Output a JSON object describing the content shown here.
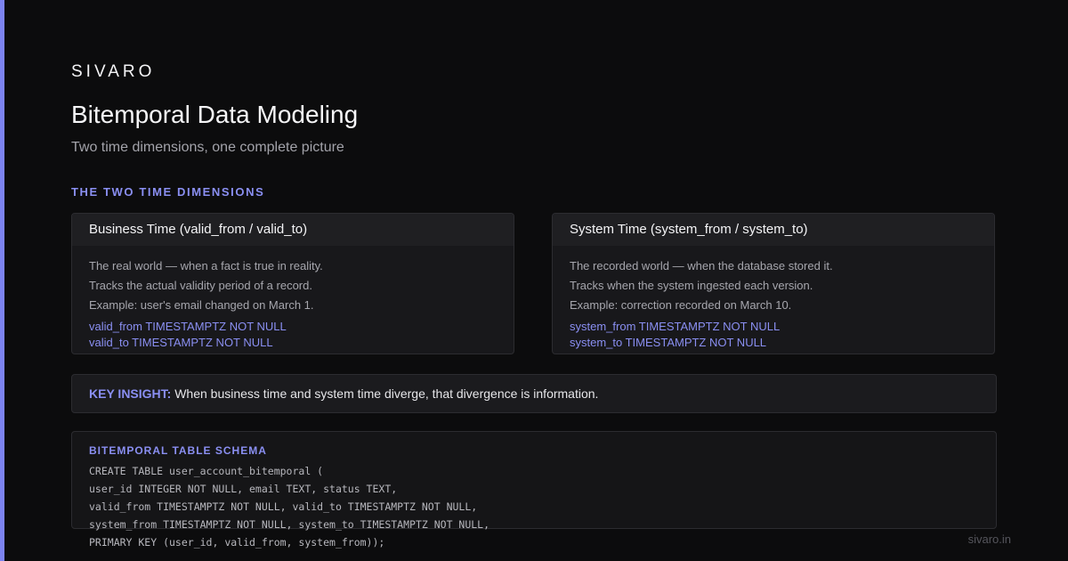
{
  "brand": "SIVARO",
  "title": "Bitemporal Data Modeling",
  "subtitle": "Two time dimensions, one complete picture",
  "section_label": "THE TWO TIME DIMENSIONS",
  "cards": [
    {
      "title": "Business Time (valid_from / valid_to)",
      "lines": [
        "The real world — when a fact is true in reality.",
        "Tracks the actual validity period of a record.",
        "Example: user's email changed on March 1."
      ],
      "code": [
        "valid_from TIMESTAMPTZ NOT NULL",
        "valid_to TIMESTAMPTZ NOT NULL"
      ]
    },
    {
      "title": "System Time (system_from / system_to)",
      "lines": [
        "The recorded world — when the database stored it.",
        "Tracks when the system ingested each version.",
        "Example: correction recorded on March 10."
      ],
      "code": [
        "system_from TIMESTAMPTZ NOT NULL",
        "system_to TIMESTAMPTZ NOT NULL"
      ]
    }
  ],
  "insight": {
    "label": "KEY INSIGHT:",
    "text": "When business time and system time diverge, that divergence is information."
  },
  "schema": {
    "label": "BITEMPORAL TABLE SCHEMA",
    "lines": [
      "CREATE TABLE user_account_bitemporal (",
      "user_id INTEGER NOT NULL, email TEXT, status TEXT,",
      "valid_from TIMESTAMPTZ NOT NULL, valid_to TIMESTAMPTZ NOT NULL,",
      "system_from TIMESTAMPTZ NOT NULL, system_to TIMESTAMPTZ NOT NULL,",
      "PRIMARY KEY (user_id, valid_from, system_from));"
    ]
  },
  "footer": "sivaro.in",
  "colors": {
    "background": "#0c0c0d",
    "accent": "#7c83f0",
    "card": "#18181b",
    "card_header": "#1f1f22",
    "border": "#2c2c30"
  }
}
